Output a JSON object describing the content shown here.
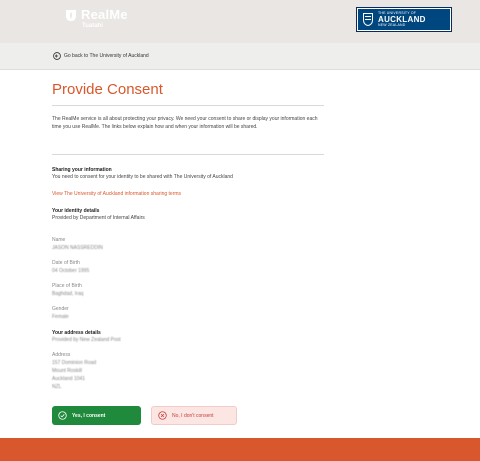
{
  "header": {
    "logo_title": "RealMe",
    "logo_subtitle": "Tuatahi",
    "university_small": "THE UNIVERSITY OF",
    "university_name": "AUCKLAND",
    "university_sub": "NEW ZEALAND"
  },
  "nav": {
    "back_label": "Go back to The University of Auckland"
  },
  "page": {
    "title": "Provide Consent",
    "intro": "The RealMe service is all about protecting your privacy. We need your consent to share or display your information each time you use RealMe. The links below explain how and when your information will be shared."
  },
  "sharing": {
    "heading": "Sharing your information",
    "text": "You need to consent for your identity to be shared with The University of Auckland",
    "link": "View The University of Auckland information sharing terms"
  },
  "identity": {
    "heading": "Your identity details",
    "provider": "Provided by Department of Internal Affairs",
    "fields": [
      {
        "label": "Name",
        "value": "JASON NASSREDDIN"
      },
      {
        "label": "Date of Birth",
        "value": "04 October 1995"
      },
      {
        "label": "Place of Birth",
        "value": "Baghdad, Iraq"
      },
      {
        "label": "Gender",
        "value": "Female"
      }
    ]
  },
  "address": {
    "heading": "Your address details",
    "provider": "Provided by New Zealand Post",
    "label": "Address",
    "lines": [
      "157 Dominion Road",
      "Mount Roskill",
      "Auckland 1041",
      "NZL"
    ]
  },
  "actions": {
    "consent": "Yes, I consent",
    "decline": "No, I don't consent"
  },
  "colors": {
    "accent": "#d9572c",
    "success": "#1f8a3b",
    "decline_bg": "#fbe6e3",
    "uoa_blue": "#00467f"
  }
}
